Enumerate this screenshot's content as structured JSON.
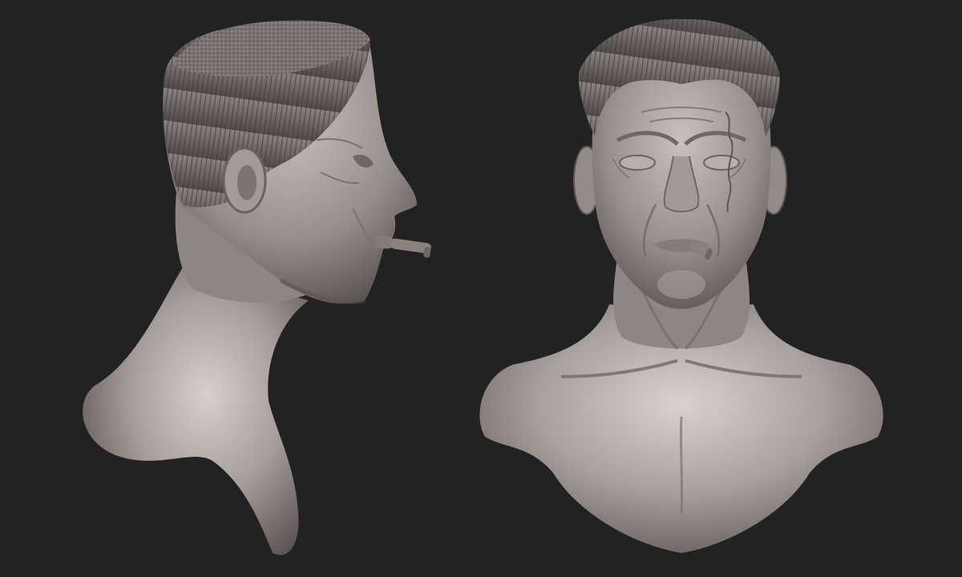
{
  "scene": {
    "background_color": "#222222",
    "clay_color": "#9a908d",
    "clay_highlight": "#d9d2cf",
    "clay_shadow": "#3a3433",
    "hair_color": "#6f6866",
    "cigar_color": "#8c817c"
  },
  "views": [
    {
      "name": "side-profile-bust",
      "facing": "right"
    },
    {
      "name": "front-view-bust",
      "facing": "viewer"
    }
  ]
}
